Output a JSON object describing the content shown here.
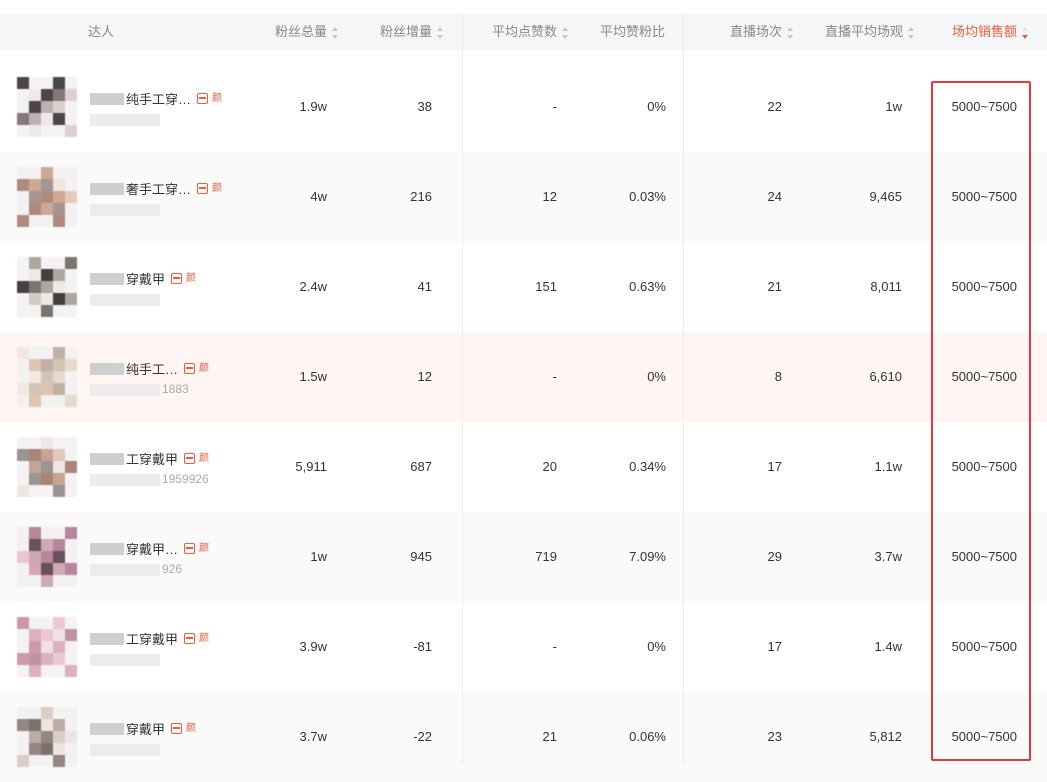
{
  "header": {
    "influencer": "达人",
    "total_fans": "粉丝总量",
    "fans_increase": "粉丝增量",
    "avg_likes": "平均点赞数",
    "avg_like_fan_ratio": "平均赞粉比",
    "live_sessions": "直播场次",
    "live_avg_views": "直播平均场观",
    "avg_session_sales": "场均销售额"
  },
  "colors": {
    "accent": "#ef5a3a",
    "highlight_box": "#e03a3a"
  },
  "rows": [
    {
      "name": "纯手工穿…",
      "sub": "",
      "total_fans": "1.9w",
      "fans_increase": "38",
      "avg_likes": "-",
      "ratio": "0%",
      "sessions": "22",
      "avg_views": "1w",
      "sales": "5000~7500"
    },
    {
      "name": "奢手工穿…",
      "sub": "",
      "total_fans": "4w",
      "fans_increase": "216",
      "avg_likes": "12",
      "ratio": "0.03%",
      "sessions": "24",
      "avg_views": "9,465",
      "sales": "5000~7500"
    },
    {
      "name": "穿戴甲",
      "sub": "",
      "total_fans": "2.4w",
      "fans_increase": "41",
      "avg_likes": "151",
      "ratio": "0.63%",
      "sessions": "21",
      "avg_views": "8,011",
      "sales": "5000~7500"
    },
    {
      "name": "纯手工…",
      "sub": "1883",
      "total_fans": "1.5w",
      "fans_increase": "12",
      "avg_likes": "-",
      "ratio": "0%",
      "sessions": "8",
      "avg_views": "6,610",
      "sales": "5000~7500"
    },
    {
      "name": "工穿戴甲",
      "sub": "1959926",
      "total_fans": "5,911",
      "fans_increase": "687",
      "avg_likes": "20",
      "ratio": "0.34%",
      "sessions": "17",
      "avg_views": "1.1w",
      "sales": "5000~7500"
    },
    {
      "name": "穿戴甲…",
      "sub": "926",
      "total_fans": "1w",
      "fans_increase": "945",
      "avg_likes": "719",
      "ratio": "7.09%",
      "sessions": "29",
      "avg_views": "3.7w",
      "sales": "5000~7500"
    },
    {
      "name": "工穿戴甲",
      "sub": "",
      "total_fans": "3.9w",
      "fans_increase": "-81",
      "avg_likes": "-",
      "ratio": "0%",
      "sessions": "17",
      "avg_views": "1.4w",
      "sales": "5000~7500"
    },
    {
      "name": "穿戴甲",
      "sub": "",
      "total_fans": "3.7w",
      "fans_increase": "-22",
      "avg_likes": "21",
      "ratio": "0.06%",
      "sessions": "23",
      "avg_views": "5,812",
      "sales": "5000~7500"
    }
  ],
  "row_tag_text": "颜"
}
